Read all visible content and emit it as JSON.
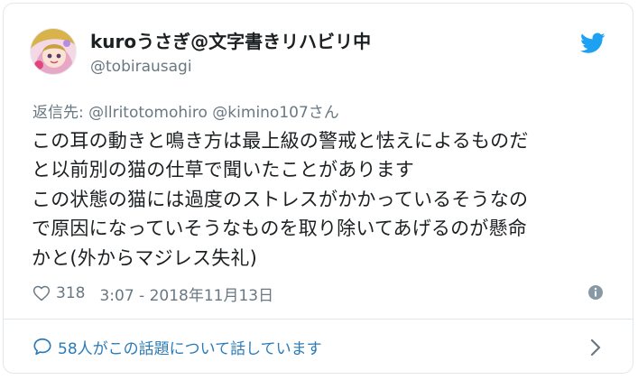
{
  "author": {
    "display_name": "kuroうさぎ@文字書きリハビリ中",
    "handle": "@tobirausagi"
  },
  "reply": {
    "prefix": "返信先:",
    "mentions": "@llritotomohiro @kimino107",
    "suffix": "さん"
  },
  "tweet": {
    "text": "この耳の動きと鳴き方は最上級の警戒と怯えによるものだ\nと以前別の猫の仕草で聞いたことがあります\nこの状態の猫には過度のストレスがかかっているそうなの\nで原因になっていそうなものを取り除いてあげるのが懸命\nかと(外からマジレス失礼)"
  },
  "stats": {
    "likes": "318",
    "timestamp": "3:07 - 2018年11月13日"
  },
  "conversation": {
    "label": "58人がこの話題について話しています"
  },
  "icons": {
    "brand": "twitter-bird-icon",
    "like": "heart-icon",
    "info": "info-icon",
    "conversation": "speech-bubble-icon",
    "chevron": "chevron-right-icon"
  },
  "colors": {
    "twitter_blue": "#1da1f2",
    "link_blue": "#2b7bb9",
    "muted": "#697882",
    "text": "#1c2022",
    "border": "#e1e8ed"
  }
}
